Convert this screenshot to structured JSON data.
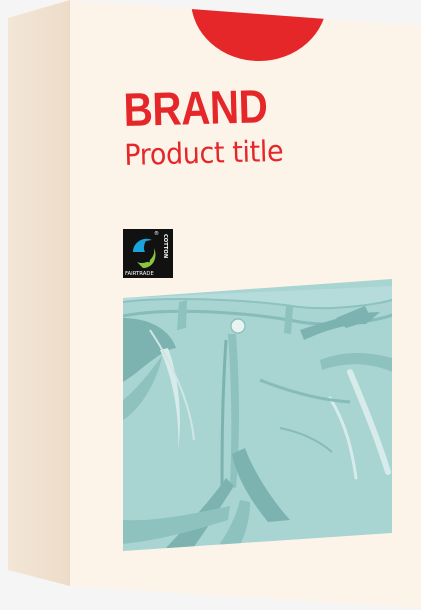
{
  "package": {
    "brand": "BRAND",
    "product_title": "Product title",
    "certification": {
      "mark_name": "fairtrade-mark-icon",
      "label": "FAIRTRADE",
      "registered_symbol": "®",
      "side_label": "COTTON"
    },
    "illustration": "denim-shorts-illustration"
  },
  "colors": {
    "background": "#f5f5f5",
    "box_front": "#fcf3e9",
    "box_side": "#f0e1cf",
    "brand_red": "#e5272a",
    "denim_light": "#a8d4d2",
    "denim_dark": "#7cb3b0",
    "denim_highlight": "#cfe6e4",
    "fairtrade_black": "#111111",
    "fairtrade_green": "#8ac640",
    "fairtrade_blue": "#1ba3dc"
  }
}
